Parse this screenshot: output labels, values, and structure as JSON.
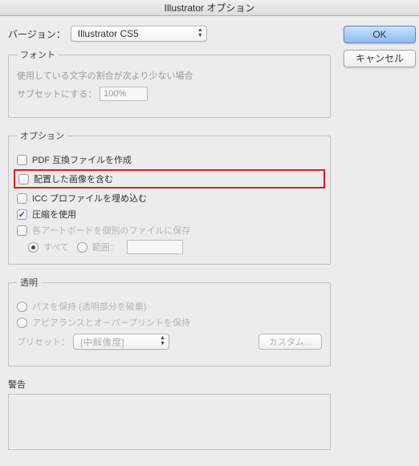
{
  "title": "Illustrator オプション",
  "version_label": "バージョン：",
  "version_value": "Illustrator CS5",
  "buttons": {
    "ok": "OK",
    "cancel": "キャンセル"
  },
  "font_group": {
    "legend": "フォント",
    "hint": "使用している文字の割合が次より少ない場合",
    "subset_label": "サブセットにする：",
    "subset_value": "100%"
  },
  "options_group": {
    "legend": "オプション",
    "pdf_compat": "PDF 互換ファイルを作成",
    "include_images": "配置した画像を含む",
    "icc_profile": "ICC プロファイルを埋め込む",
    "compress": "圧縮を使用",
    "save_artboards": "各アートボードを個別のファイルに保存",
    "all": "すべて",
    "range": "範囲："
  },
  "transparency_group": {
    "legend": "透明",
    "preserve_paths": "パスを保持 (透明部分を破棄)",
    "preserve_appearance": "アピアランスとオーバープリントを保持",
    "preset_label": "プリセット：",
    "preset_value": "[中解像度]",
    "custom": "カスタム..."
  },
  "warnings": {
    "label": "警告"
  }
}
